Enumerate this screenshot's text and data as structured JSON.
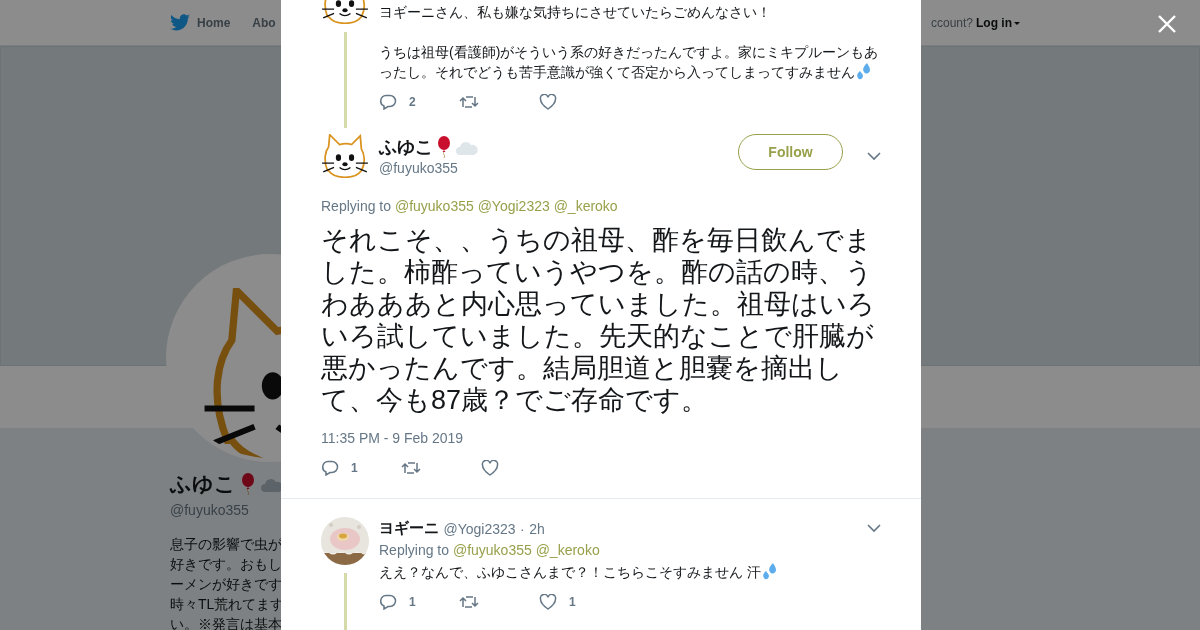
{
  "background": {
    "nav": [
      {
        "label": "Home"
      },
      {
        "label": "Abo"
      }
    ],
    "account_prompt": "ccount?",
    "login": "Log in",
    "profile": {
      "name": "ふゆこ",
      "handle": "@fuyuko355",
      "bio_lines": [
        "息子の影響で虫が",
        "好きです。おもし",
        "ーメンが好きです",
        "時々TL荒れてます",
        "い。※発言は基本"
      ]
    }
  },
  "tweets": [
    {
      "kind": "parent",
      "connected": true,
      "paragraphs": [
        "ヨギーニさん、私も嫌な気持ちにさせていたらごめんなさい！",
        "うちは祖母(看護師)がそういう系の好きだったんですよ。家にミキプルーンもあったし。それでどうも苦手意識が強くて否定から入ってしまってすみません"
      ],
      "replies": "2"
    },
    {
      "kind": "focused",
      "name": "ふゆこ",
      "handle": "@fuyuko355",
      "follow": "Follow",
      "replying_label": "Replying to",
      "mentions": [
        "@fuyuko355",
        "@Yogi2323",
        "@_keroko"
      ],
      "paragraphs": [
        "それこそ、、うちの祖母、酢を毎日飲んでました。柿酢っていうやつを。酢の話の時、うわあああと内心思っていました。祖母はいろいろ試していました。先天的なことで肝臓が悪かったんです。結局胆道と胆嚢を摘出して、今も87歳？でご存命です。"
      ],
      "time": "11:35 PM - 9 Feb 2019",
      "replies": "1"
    },
    {
      "kind": "reply",
      "connected": true,
      "name": "ヨギーニ",
      "handle": "@Yogi2323",
      "dot": "·",
      "time": "2h",
      "replying_label": "Replying to",
      "mentions": [
        "@fuyuko355",
        "@_keroko"
      ],
      "paragraphs": [
        "ええ？なんで、ふゆこさんまで？！こちらこそすみません 汗"
      ],
      "replies": "1",
      "likes": "1"
    }
  ]
}
